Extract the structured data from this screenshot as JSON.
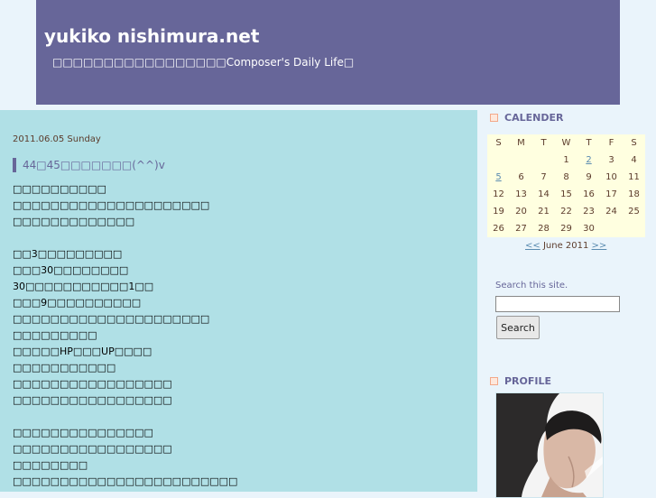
{
  "header": {
    "title": "yukiko nishimura.net",
    "description": "□□□□□□□□□□□□□□□□□Composer's Daily Life□"
  },
  "post": {
    "date": "2011.06.05 Sunday",
    "title": "44□45□□□□□□□(^^)v",
    "lines": [
      "□□□□□□□□□□",
      "□□□□□□□□□□□□□□□□□□□□□",
      "□□□□□□□□□□□□□",
      "",
      "□□3□□□□□□□□□",
      "□□□30□□□□□□□□",
      "30□□□□□□□□□□□1□□",
      "□□□9□□□□□□□□□□",
      "□□□□□□□□□□□□□□□□□□□□□",
      "□□□□□□□□□",
      "□□□□□HP□□□UP□□□□",
      "□□□□□□□□□□□",
      "□□□□□□□□□□□□□□□□□",
      "□□□□□□□□□□□□□□□□□",
      "",
      "□□□□□□□□□□□□□□□",
      "□□□□□□□□□□□□□□□□□",
      "□□□□□□□□",
      "□□□□□□□□□□□□□□□□□□□□□□□□"
    ]
  },
  "sidebar": {
    "calendar_heading": "CALENDER",
    "weekdays": [
      "S",
      "M",
      "T",
      "W",
      "T",
      "F",
      "S"
    ],
    "weeks": [
      [
        "",
        "",
        "",
        "1",
        "2",
        "3",
        "4"
      ],
      [
        "5",
        "6",
        "7",
        "8",
        "9",
        "10",
        "11"
      ],
      [
        "12",
        "13",
        "14",
        "15",
        "16",
        "17",
        "18"
      ],
      [
        "19",
        "20",
        "21",
        "22",
        "23",
        "24",
        "25"
      ],
      [
        "26",
        "27",
        "28",
        "29",
        "30",
        "",
        ""
      ]
    ],
    "linked_days": [
      "2",
      "5"
    ],
    "prev_label": "<<",
    "month_label": "June 2011",
    "next_label": ">>",
    "search_label": "Search this site.",
    "search_value": "",
    "search_button": "Search",
    "profile_heading": "PROFILE"
  },
  "colors": {
    "header_bg": "#676699",
    "main_bg": "#b0e0e6",
    "page_bg": "#eaf4fb",
    "calendar_bg": "#ffffe0",
    "accent_text": "#676699"
  }
}
